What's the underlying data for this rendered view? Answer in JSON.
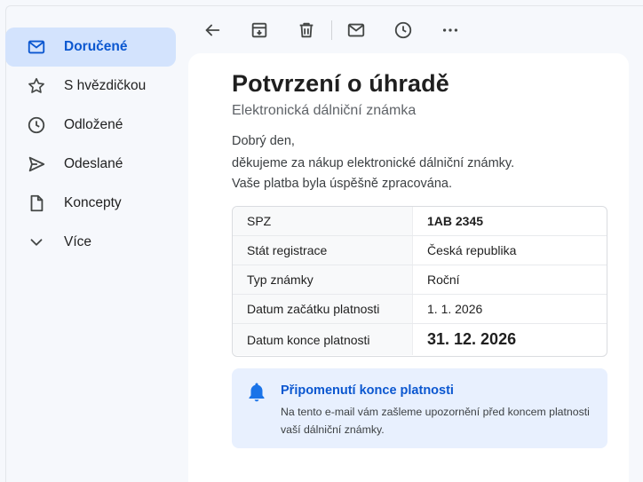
{
  "sidebar": {
    "items": [
      {
        "label": "Doručené",
        "icon": "mail-icon",
        "active": true
      },
      {
        "label": "S hvězdičkou",
        "icon": "star-icon"
      },
      {
        "label": "Odložené",
        "icon": "clock-icon"
      },
      {
        "label": "Odeslané",
        "icon": "send-icon"
      },
      {
        "label": "Koncepty",
        "icon": "draft-icon"
      },
      {
        "label": "Více",
        "icon": "chevron-down-icon"
      }
    ]
  },
  "toolbar": {
    "icons": [
      "back-arrow-icon",
      "archive-icon",
      "trash-icon",
      "mark-unread-icon",
      "snooze-icon",
      "more-icon"
    ]
  },
  "email": {
    "title": "Potvrzení o úhradě",
    "subtitle": "Elektronická dálniční známka",
    "greeting": "Dobrý den,",
    "line1": "děkujeme za nákup elektronické dálniční známky.",
    "line2": "Vaše platba byla úspěšně zpracována.",
    "details": [
      {
        "label": "SPZ",
        "value": "1AB 2345"
      },
      {
        "label": "Stát registrace",
        "value": "Česká republika"
      },
      {
        "label": "Typ známky",
        "value": "Roční"
      },
      {
        "label": "Datum začátku platnosti",
        "value": "1. 1. 2026"
      },
      {
        "label": "Datum konce platnosti",
        "value": "31. 12. 2026"
      }
    ],
    "reminder": {
      "title": "Připomenutí konce platnosti",
      "text": "Na tento e-mail vám zašleme upozornění před koncem platnosti vaší dálniční známky.",
      "icon": "bell-icon"
    }
  },
  "colors": {
    "accent": "#0b57d0",
    "active_nav_bg": "#d3e3fd",
    "reminder_bg": "#e8f0fe",
    "page_bg": "#f6f8fc"
  }
}
